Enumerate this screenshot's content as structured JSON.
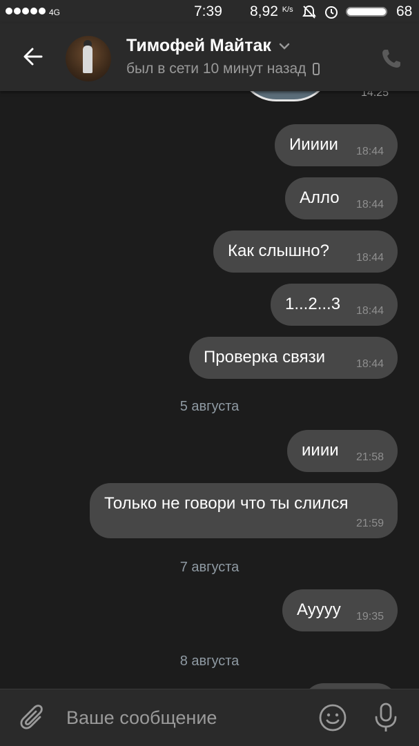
{
  "status_bar": {
    "network": "4G",
    "time": "7:39",
    "speed_value": "8,92",
    "speed_unit": "K/s",
    "battery": "68"
  },
  "header": {
    "contact_name": "Тимофей Майтак",
    "last_seen": "был в сети 10 минут назад"
  },
  "chat": {
    "prev_sticker_time": "14:25",
    "messages": [
      {
        "text": "Иииии",
        "time": "18:44"
      },
      {
        "text": "Алло",
        "time": "18:44"
      },
      {
        "text": "Как слышно?",
        "time": "18:44"
      },
      {
        "text": "1...2...3",
        "time": "18:44"
      },
      {
        "text": "Проверка связи",
        "time": "18:44"
      },
      {
        "text": "ииии",
        "time": "21:58"
      },
      {
        "text": "Только не говори что ты слился",
        "time": "21:59"
      },
      {
        "text": "Ауууу",
        "time": "19:35"
      }
    ],
    "dates": [
      "5 августа",
      "7 августа",
      "8 августа"
    ]
  },
  "input": {
    "placeholder": "Ваше сообщение"
  },
  "colors": {
    "background": "#1c1c1c",
    "bar": "#2a2a2a",
    "bubble": "#474747",
    "muted_text": "#9a9a9a"
  },
  "icons": [
    "back-arrow-icon",
    "chevron-down-icon",
    "phone-device-icon",
    "call-icon",
    "attachment-icon",
    "emoji-icon",
    "microphone-icon"
  ]
}
